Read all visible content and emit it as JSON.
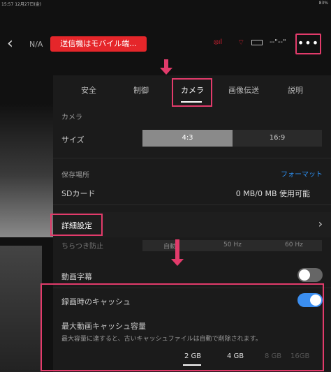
{
  "statusbar": {
    "left": "15:57  12月27日(金)",
    "right": "83%"
  },
  "topbar": {
    "back_icon": "chevron-left-icon",
    "mode": "N/A",
    "warning": "送信機はモバイル端...",
    "dashes": "--\"--\"",
    "more_label": "•••"
  },
  "tabs": [
    {
      "label": "安全"
    },
    {
      "label": "制御"
    },
    {
      "label": "カメラ"
    },
    {
      "label": "画像伝送"
    },
    {
      "label": "説明"
    }
  ],
  "camera": {
    "section": "カメラ",
    "size_label": "サイズ",
    "size_options": [
      "4:3",
      "16:9"
    ],
    "storage_section": "保存場所",
    "format_link": "フォーマット",
    "sd_label": "SDカード",
    "sd_value": "0 MB/0 MB 使用可能",
    "advanced_label": "詳細設定"
  },
  "advanced": {
    "partial_label": "ちらつき防止",
    "partial_options": [
      "自動",
      "50 Hz",
      "60 Hz"
    ],
    "subtitle_label": "動画字幕",
    "cache_label": "録画時のキャッシュ",
    "max_cache_label": "最大動画キャッシュ容量",
    "max_cache_desc": "最大容量に達すると、古いキャッシュファイルは自動で削除されます。",
    "cache_options": [
      "2 GB",
      "4 GB",
      "8 GB",
      "16GB"
    ]
  },
  "colors": {
    "accent": "#e23b6b",
    "warning": "#e5262a",
    "link": "#2d8ff0",
    "toggle_on": "#3b8ef0"
  }
}
